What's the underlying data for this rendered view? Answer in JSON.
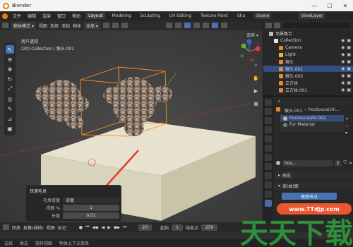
{
  "app_title": "Blender",
  "menu": {
    "items": [
      "文件",
      "编辑",
      "渲染",
      "窗口",
      "帮助"
    ]
  },
  "workspaces": [
    "Layout",
    "Modeling",
    "Sculpting",
    "UV Editing",
    "Texture Paint",
    "Sha"
  ],
  "scene": {
    "label": "Scene",
    "view_layer": "ViewLayer"
  },
  "header": {
    "mode": "物体模式",
    "menus": [
      "视图",
      "选择",
      "添加",
      "物体"
    ],
    "orientation": "全局",
    "options_label": "选项"
  },
  "viewport": {
    "line1": "用户透视",
    "line2": "(20) Collection | 猴头.001"
  },
  "quick_panel": {
    "title": "快速毛发",
    "rows": [
      {
        "label": "毛发密度",
        "value": "浓度"
      },
      {
        "label": "视图 %",
        "value": "1"
      },
      {
        "label": "长度",
        "value": "0.01"
      }
    ]
  },
  "outliner": {
    "header_label": "场景集合",
    "items": [
      {
        "name": "Collection",
        "color": "#e8e8e8",
        "selected": false,
        "indent": 1
      },
      {
        "name": "Camera",
        "color": "#e08a3a",
        "selected": false,
        "indent": 2
      },
      {
        "name": "Light",
        "color": "#e0c03a",
        "selected": false,
        "indent": 2
      },
      {
        "name": "猴头",
        "color": "#e08a3a",
        "selected": false,
        "indent": 2
      },
      {
        "name": "猴头.001",
        "color": "#e08a3a",
        "selected": true,
        "indent": 2
      },
      {
        "name": "猴头.002",
        "color": "#e08a3a",
        "selected": false,
        "indent": 2
      },
      {
        "name": "立方体",
        "color": "#e08a3a",
        "selected": false,
        "indent": 2
      },
      {
        "name": "立方体.001",
        "color": "#e08a3a",
        "selected": false,
        "indent": 2
      }
    ]
  },
  "properties": {
    "breadcrumb": [
      "猴头.001",
      "houtoucaizhi..."
    ],
    "materials": [
      "houtoucaizhi.002",
      "Fur Material"
    ],
    "material_field": "hou...",
    "user_count": "2",
    "panels": [
      "预览",
      "表(曲)面"
    ],
    "use_nodes": "使用节点"
  },
  "timeline": {
    "menus": [
      "回放",
      "抠像(插帧)",
      "视图",
      "标记"
    ],
    "current_frame": "20",
    "start_label": "起始",
    "start": "1",
    "end_label": "结束点",
    "end": "250"
  },
  "status": {
    "items": [
      "选择",
      "框选",
      "旋转视图",
      "物体上下文菜单"
    ]
  },
  "watermark": {
    "chars": "天天下载",
    "url": "www.TTdjp.com"
  },
  "colors": {
    "accent": "#4772b3",
    "selection": "#ff8c1a",
    "arrow": "#e23c2c"
  }
}
